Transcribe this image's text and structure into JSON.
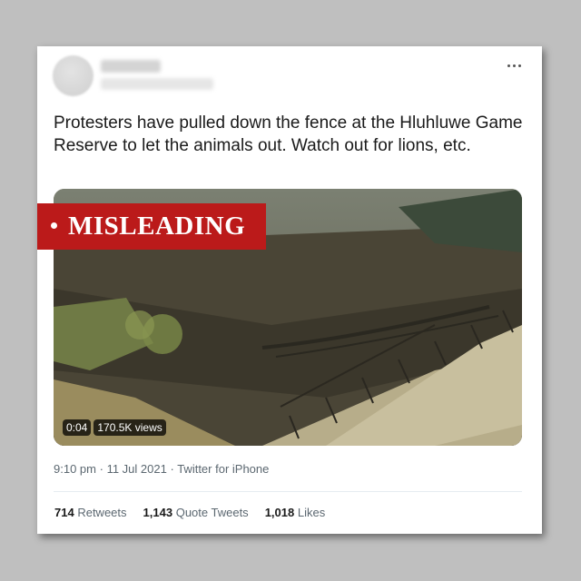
{
  "tweet": {
    "text": "Protesters have pulled down the fence at the Hluhluwe Game Reserve to let the animals out. Watch out for lions, etc.",
    "more_icon": "more-horizontal-icon"
  },
  "media": {
    "label": "MISLEADING",
    "duration": "0:04",
    "views": "170.5K views"
  },
  "meta": {
    "time": "9:10 pm",
    "separator": "·",
    "date": "11 Jul 2021",
    "source": "Twitter for iPhone"
  },
  "stats": {
    "retweets_count": "714",
    "retweets_label": "Retweets",
    "quotes_count": "1,143",
    "quotes_label": "Quote Tweets",
    "likes_count": "1,018",
    "likes_label": "Likes"
  },
  "colors": {
    "badge": "#bb1a1a",
    "background": "#bfbfbf",
    "muted_text": "#5b6770"
  }
}
